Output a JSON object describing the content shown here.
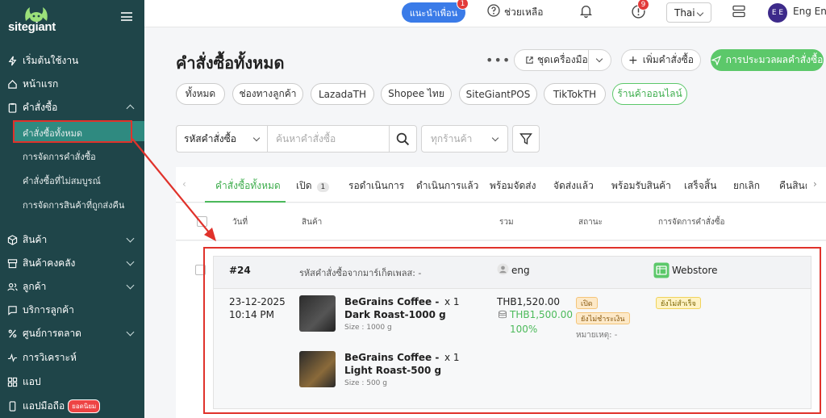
{
  "sidebar": {
    "logo_text": "sitegiant",
    "items": [
      {
        "label": "เริ่มต้นใช้งาน",
        "icon": "bolt-icon"
      },
      {
        "label": "หน้าแรก",
        "icon": "home-icon"
      },
      {
        "label": "คำสั่งซื้อ",
        "icon": "clipboard-icon"
      },
      {
        "label": "สินค้า",
        "icon": "box-icon"
      },
      {
        "label": "สินค้าคงคลัง",
        "icon": "warehouse-icon"
      },
      {
        "label": "ลูกค้า",
        "icon": "users-icon"
      },
      {
        "label": "บริการลูกค้า",
        "icon": "chat-icon"
      },
      {
        "label": "ศูนย์การตลาด",
        "icon": "percent-icon"
      },
      {
        "label": "การวิเคราะห์",
        "icon": "analytics-icon"
      },
      {
        "label": "แอป",
        "icon": "grid-icon"
      },
      {
        "label": "แอปมือถือ",
        "icon": "mobile-icon",
        "badge": "ยอดนิยม"
      }
    ],
    "order_sub_items": [
      "คำสั่งซื้อทั้งหมด",
      "การจัดการคำสั่งซื้อ",
      "คำสั่งซื้อที่ไม่สมบูรณ์",
      "การจัดการสินค้าที่ถูกส่งคืน"
    ]
  },
  "topbar": {
    "invite_label": "แนะนำเพื่อน",
    "invite_count": "1",
    "help_label": "ช่วยเหลือ",
    "alert_count": "9",
    "language": "Thai",
    "avatar_initials": "E E",
    "user_name": "Eng Eng"
  },
  "header": {
    "title": "คำสั่งซื้อทั้งหมด",
    "toolkit_label": "ชุดเครื่องมือ",
    "add_order_label": "เพิ่มคำสั่งซื้อ",
    "process_label": "การประมวลผลคำสั่งซื้อ"
  },
  "channel_chips": [
    "ทั้งหมด",
    "ช่องทางลูกค้า",
    "LazadaTH",
    "Shopee ไทย",
    "SiteGiantPOS",
    "TikTokTH",
    "ร้านค้าออนไลน์"
  ],
  "filters": {
    "search_type": "รหัสคำสั่งซื้อ",
    "search_placeholder": "ค้นหาคำสั่งซื้อ",
    "store_placeholder": "ทุกร้านค้า"
  },
  "tabs": [
    {
      "label": "คำสั่งซื้อทั้งหมด"
    },
    {
      "label": "เปิด",
      "count": "1"
    },
    {
      "label": "รอดำเนินการ"
    },
    {
      "label": "ดำเนินการแล้ว"
    },
    {
      "label": "พร้อมจัดส่ง"
    },
    {
      "label": "จัดส่งแล้ว"
    },
    {
      "label": "พร้อมรับสินค้า"
    },
    {
      "label": "เสร็จสิ้น"
    },
    {
      "label": "ยกเลิก"
    },
    {
      "label": "คืนสินค้"
    }
  ],
  "table_headers": [
    "วันที่",
    "สินค้า",
    "รวม",
    "สถานะ",
    "การจัดการคำสั่งซื้อ"
  ],
  "order": {
    "number": "#24",
    "marketplace_ref": "รหัสคำสั่งซื้อจากมาร์เก็ตเพลส: -",
    "customer": "eng",
    "channel": "Webstore",
    "date": "23-12-2025",
    "time": "10:14 PM",
    "total": "THB1,520.00",
    "paid": "THB1,500.00",
    "paid_percent": "100%",
    "status_open": "เปิด",
    "status_payment": "ยังไม่ชำระเงิน",
    "note": "หมายเหตุ: -",
    "fulfillment": "ยังไม่สำเร็จ",
    "items": [
      {
        "name_line1": "BeGrains Coffee -",
        "name_line2": "Dark Roast-1000 g",
        "size": "Size : 1000 g",
        "qty": "x 1"
      },
      {
        "name_line1": "BeGrains Coffee -",
        "name_line2": "Light Roast-500 g",
        "size": "Size : 500 g",
        "qty": "x 1"
      }
    ]
  },
  "colors": {
    "sidebar": "#1f4549",
    "accent_green": "#5cc86a",
    "highlight_red": "#e0322b",
    "invite_blue": "#3a7be8"
  }
}
